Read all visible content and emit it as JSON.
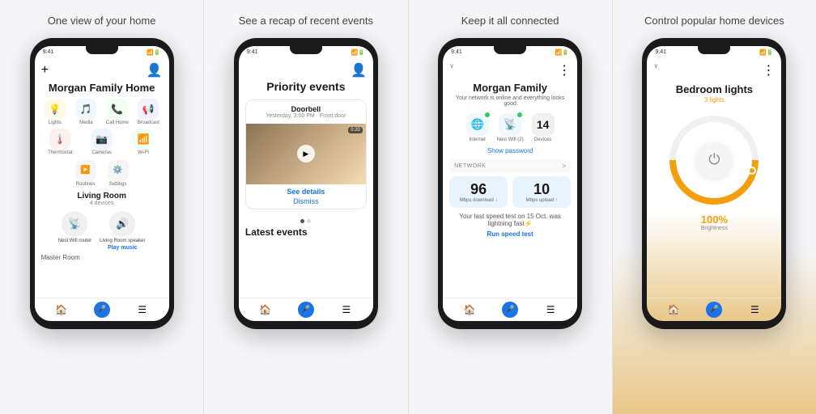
{
  "panels": [
    {
      "id": "panel1",
      "title": "One view of your home",
      "phone": {
        "time": "9:41",
        "home_title": "Morgan Family Home",
        "icons_row1": [
          {
            "icon": "💡",
            "label": "Lights",
            "bg": "#fff9e6"
          },
          {
            "icon": "🎵",
            "label": "Media",
            "bg": "#f0f8ff"
          },
          {
            "icon": "📞",
            "label": "Call Home",
            "bg": "#f0fff0"
          },
          {
            "icon": "📢",
            "label": "Broadcast",
            "bg": "#f5f0ff"
          }
        ],
        "icons_row2": [
          {
            "icon": "🌡️",
            "label": "Thermostat",
            "bg": "#fff0f0"
          },
          {
            "icon": "📷",
            "label": "Cameras",
            "bg": "#f0f4ff"
          },
          {
            "icon": "📶",
            "label": "Wi-Fi",
            "bg": "#f0fff4"
          }
        ],
        "routines": "Routines",
        "settings": "Settings",
        "room": "Living Room",
        "room_devices": "4 devices",
        "device1": "Nest Wifi router",
        "device2": "Living Room speaker",
        "play_music": "Play music",
        "bottom_room": "Master Room"
      }
    },
    {
      "id": "panel2",
      "title": "See a recap of recent events",
      "phone": {
        "time": "9:41",
        "section_title": "Priority events",
        "event_device": "Doorbell",
        "event_time": "Yesterday, 3:00 PM · Front door",
        "video_duration": "0:20",
        "see_details": "See details",
        "dismiss": "Dismiss",
        "latest_title": "Latest events"
      }
    },
    {
      "id": "panel3",
      "title": "Keep it all connected",
      "phone": {
        "time": "9:41",
        "home_title": "Morgan Family",
        "subtitle": "Your network is online and everything looks good",
        "net_items": [
          {
            "icon": "🌐",
            "label": "Internet",
            "count": null
          },
          {
            "icon": "📡",
            "label": "Nest Wifi (2)",
            "count": null
          },
          {
            "icon": "14",
            "label": "Devices",
            "count": "14"
          }
        ],
        "show_password": "Show password",
        "network_label": "NETWORK",
        "download": "96",
        "download_unit": "Mbps download ↓",
        "upload": "10",
        "upload_unit": "Mbps upload ↑",
        "speed_test_text": "Your last speed test on 15 Oct. was lightning fast⚡",
        "run_speed": "Run speed test"
      }
    },
    {
      "id": "panel4",
      "title": "Control popular home devices",
      "phone": {
        "time": "9:41",
        "device_title": "Bedroom lights",
        "device_sub": "3 lights",
        "brightness_pct": "100%",
        "brightness_label": "Brightness"
      }
    }
  ]
}
